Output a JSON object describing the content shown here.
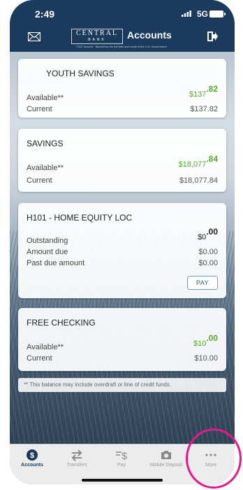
{
  "status_bar": {
    "time": "2:49",
    "network": "5G"
  },
  "header": {
    "logo_main": "CENTRAL",
    "logo_sub": "BANK",
    "title": "Accounts",
    "fdic_text": "FDIC Insured · Backed by the full faith and credit of the U.S. Government"
  },
  "accounts": [
    {
      "name": "YOUTH SAVINGS",
      "available_label": "Available**",
      "available_dollars": "$137",
      "available_cents": ".82",
      "current_label": "Current",
      "current_value": "$137.82"
    },
    {
      "name": "SAVINGS",
      "available_label": "Available**",
      "available_dollars": "$18,077",
      "available_cents": ".84",
      "current_label": "Current",
      "current_value": "$18,077.84"
    },
    {
      "name": "H101 - HOME EQUITY LOC",
      "outstanding_label": "Outstanding",
      "outstanding_dollars": "$0",
      "outstanding_cents": ".00",
      "amount_due_label": "Amount due",
      "amount_due_value": "$0.00",
      "past_due_label": "Past due amount",
      "past_due_value": "$0.00",
      "pay_label": "PAY"
    },
    {
      "name": "FREE CHECKING",
      "available_label": "Available**",
      "available_dollars": "$10",
      "available_cents": ".00",
      "current_label": "Current",
      "current_value": "$10.00"
    }
  ],
  "footnote": "** This balance may include overdraft or line of credit funds.",
  "tabs": [
    {
      "label": "Accounts",
      "icon": "dollar-circle-icon",
      "active": true
    },
    {
      "label": "Transfers",
      "icon": "transfer-arrows-icon",
      "active": false
    },
    {
      "label": "Pay",
      "icon": "pay-icon",
      "active": false
    },
    {
      "label": "Mobile Deposit",
      "icon": "camera-icon",
      "active": false
    },
    {
      "label": "More",
      "icon": "more-dots-icon",
      "active": false
    }
  ],
  "colors": {
    "brand_navy": "#1b3a5c",
    "positive_green": "#5aa834",
    "highlight_pink": "#e5198a"
  }
}
